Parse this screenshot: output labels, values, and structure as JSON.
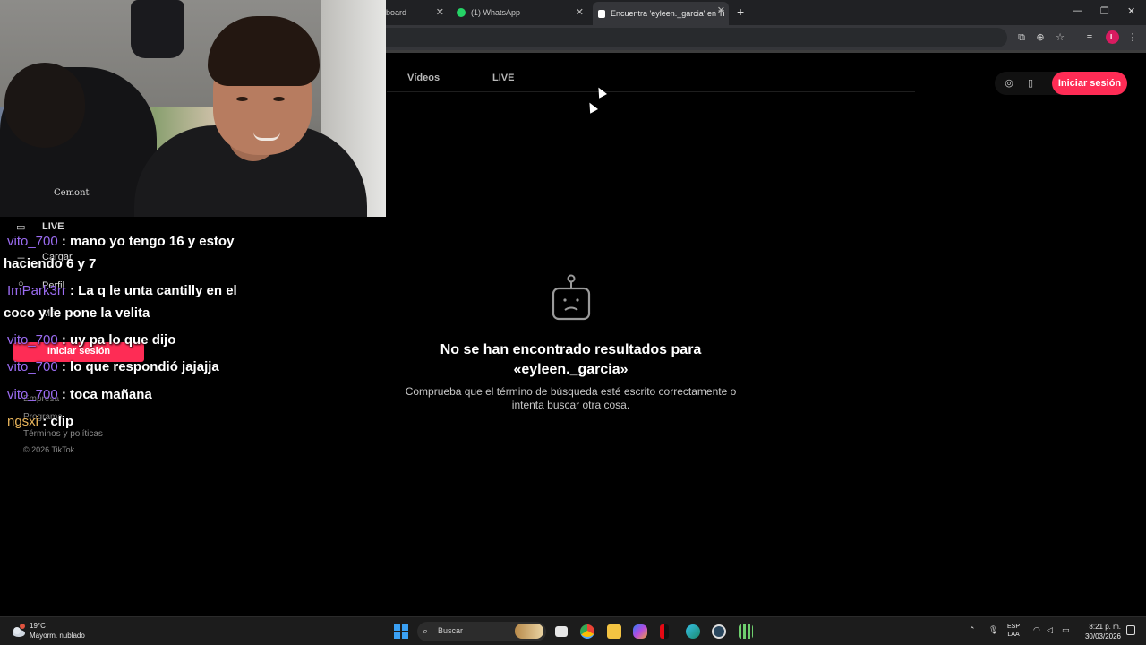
{
  "browser": {
    "tabs": [
      {
        "label": "board",
        "favicon_color": "#5f6368"
      },
      {
        "label": "(1) WhatsApp",
        "favicon_color": "#25d366"
      },
      {
        "label": "Encuentra 'eyleen._garcia' en Ti",
        "favicon_color": "#ffffff",
        "active": true
      }
    ],
    "new_tab": "+",
    "profile_initial": "L"
  },
  "tiktok": {
    "nav_tabs": [
      "Vídeos",
      "LIVE"
    ],
    "login_label": "Iniciar sesión",
    "empty_title": "No se han encontrado resultados para «eyleen._garcia»",
    "empty_desc": "Comprueba que el término de búsqueda esté escrito correctamente o intenta buscar otra cosa.",
    "sidebar": {
      "live": "LIVE",
      "upload": "Cargar",
      "profile": "Perfil",
      "more": "Más",
      "login": "Iniciar sesión",
      "company": "Empresa",
      "program": "Programa",
      "terms": "Términos y políticas",
      "copyright": "© 2026 TikTok"
    }
  },
  "stream": {
    "shirt_text": "Cemont",
    "chat": [
      {
        "user": "vito_700",
        "text": " : mano yo tengo 16 y estoy haciendo 6 y 7",
        "user_color": "#9b6cf2"
      },
      {
        "user": "ImPark3rr",
        "text": " : La q le unta cantilly en el coco y le pone la velita",
        "user_color": "#9b6cf2"
      },
      {
        "user": "vito_700",
        "text": " : uy pa lo que dijo",
        "user_color": "#9b6cf2"
      },
      {
        "user": "vito_700",
        "text": " : lo que respondió jajajja",
        "user_color": "#9b6cf2"
      },
      {
        "user": "vito_700",
        "text": " : toca mañana",
        "user_color": "#9b6cf2"
      },
      {
        "user": "ngsxi",
        "text": " : clip",
        "user_color": "#e8b45a"
      }
    ]
  },
  "taskbar": {
    "weather_temp": "19°C",
    "weather_desc": "Mayorm. nublado",
    "search_placeholder": "Buscar",
    "lang_top": "ESP",
    "lang_bottom": "LAA",
    "time": "8:21 p. m.",
    "date": "30/03/2026"
  }
}
